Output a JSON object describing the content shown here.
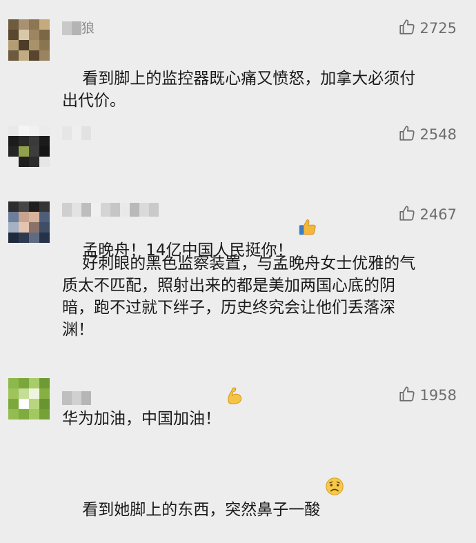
{
  "comments": [
    {
      "user_suffix": "狼",
      "likes": "2725",
      "text": "看到脚上的监控器既心痛又愤怒，加拿大必须付\n出代价。",
      "emoji": ""
    },
    {
      "user_suffix": "",
      "likes": "2548",
      "text": "孟晚舟！14亿中国人民挺你！",
      "emoji": "thumbs-up"
    },
    {
      "user_suffix": "",
      "likes": "2467",
      "text": "好刺眼的黑色监察装置，与孟晚舟女士优雅的气\n质太不匹配，照射出来的都是美加两国心底的阴\n暗，跑不过就下绊子，历史终究会让他们丢落深\n渊！\n华为加油，中国加油！",
      "emoji": "flexed-biceps"
    },
    {
      "user_suffix": "",
      "likes": "1958",
      "text": "看到她脚上的东西，突然鼻子一酸",
      "emoji": "sad-face"
    }
  ],
  "colors": {
    "background": "#ededed",
    "text": "#1a1a1a",
    "meta": "#6d6d6d"
  }
}
